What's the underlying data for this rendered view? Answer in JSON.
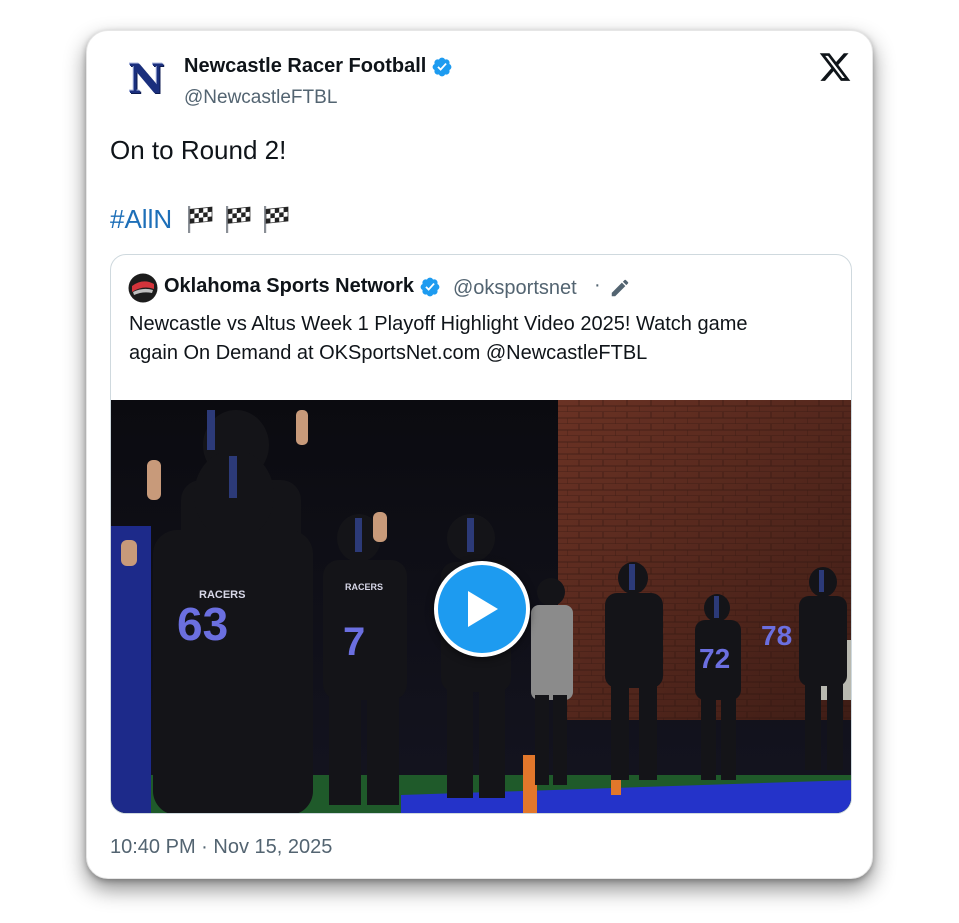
{
  "author": {
    "avatar_letter": "N",
    "display_name": "Newcastle Racer Football",
    "handle": "@NewcastleFTBL",
    "verified": true
  },
  "tweet": {
    "text": "On to Round 2!",
    "hashtag": "#AllN",
    "emoji": "chequered-flag",
    "emoji_count": 3,
    "timestamp": "10:40 PM · Nov 15, 2025"
  },
  "quoted": {
    "display_name": "Oklahoma Sports Network",
    "handle": "@oksportsnet",
    "separator": "·",
    "verified": true,
    "text_line1": "Newcastle vs Altus Week 1 Playoff Highlight Video 2025! Watch game",
    "text_line2": "again On Demand at OKSportsNet.com @NewcastleFTBL",
    "media": {
      "jersey_numbers": [
        "63",
        "7",
        "72",
        "78"
      ],
      "jersey_text": "RACERS"
    }
  },
  "colors": {
    "link": "#1d6fb8",
    "verified": "#1d9bf0",
    "secondary_text": "#536471",
    "brand_navy": "#1a2f7d"
  },
  "icons": {
    "x_logo": "x-logo-icon",
    "verified": "verified-badge-icon",
    "edit": "edit-pencil-icon",
    "play": "play-icon"
  }
}
